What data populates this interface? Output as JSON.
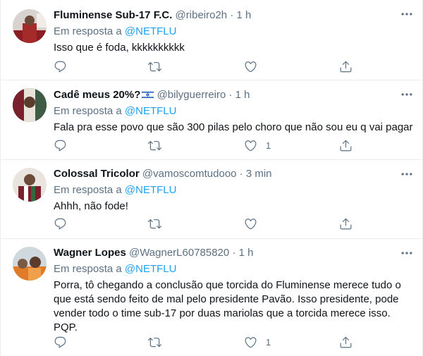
{
  "tweets": [
    {
      "name": "Fluminense Sub-17 F.C.",
      "handle": "@ribeiro2h",
      "separator": "·",
      "time": "1 h",
      "reply_prefix": "Em resposta a",
      "reply_to": "@NETFLU",
      "text": "Isso que é foda, kkkkkkkkkk",
      "likes": ""
    },
    {
      "name": "Cadê meus 20%?",
      "name_flag": "israel-flag-icon",
      "handle": "@bilyguerreiro",
      "separator": "·",
      "time": "1 h",
      "reply_prefix": "Em resposta a",
      "reply_to": "@NETFLU",
      "text": "Fala pra esse povo que são 300 pilas pelo choro que não sou eu q vai pagar",
      "likes": "1"
    },
    {
      "name": "Colossal Tricolor",
      "handle": "@vamoscomtudooo",
      "separator": "·",
      "time": "3 min",
      "reply_prefix": "Em resposta a",
      "reply_to": "@NETFLU",
      "text": "Ahhh, não fode!",
      "likes": ""
    },
    {
      "name": "Wagner Lopes",
      "handle": "@WagnerL60785820",
      "separator": "·",
      "time": "1 h",
      "reply_prefix": "Em resposta a",
      "reply_to": "@NETFLU",
      "text": "Porra, tô chegando a conclusão que torcida do Fluminense merece tudo o que está sendo feito de mal pelo presidente Pavão. Isso presidente, pode vender todo o time sub-17 por duas mariolas que a torcida merece isso. PQP.",
      "likes": "1"
    }
  ],
  "icons": {
    "reply": "reply-icon",
    "retweet": "retweet-icon",
    "like": "like-icon",
    "share": "share-icon",
    "more": "more-options-icon"
  },
  "colors": {
    "text": "#0f1419",
    "muted": "#5b7083",
    "link": "#1da1f2",
    "divider": "#ebeef0"
  }
}
